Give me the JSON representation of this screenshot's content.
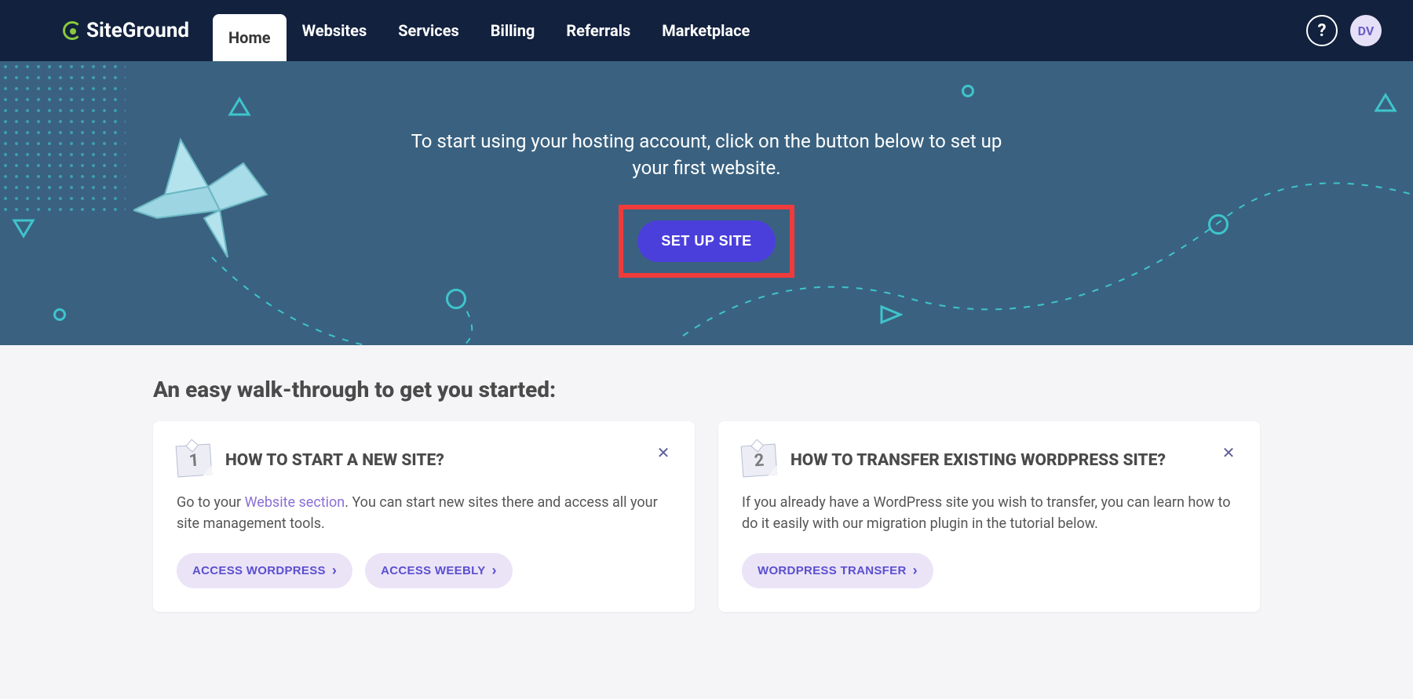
{
  "brand": "SiteGround",
  "nav": [
    "Home",
    "Websites",
    "Services",
    "Billing",
    "Referrals",
    "Marketplace"
  ],
  "nav_active_index": 0,
  "help_label": "?",
  "avatar_initials": "DV",
  "hero": {
    "text": "To start using your hosting account, click on the button below to set up your first website.",
    "button": "SET UP SITE"
  },
  "section_title": "An easy walk-through to get you started:",
  "cards": [
    {
      "num": "1",
      "title": "HOW TO START A NEW SITE?",
      "desc_pre": "Go to your ",
      "desc_link": "Website section",
      "desc_post": ". You can start new sites there and access all your site management tools.",
      "buttons": [
        "ACCESS WORDPRESS",
        "ACCESS WEEBLY"
      ]
    },
    {
      "num": "2",
      "title": "HOW TO TRANSFER EXISTING WORDPRESS SITE?",
      "desc_full": "If you already have a WordPress site you wish to transfer, you can learn how to do it easily with our migration plugin in the tutorial below.",
      "buttons": [
        "WORDPRESS TRANSFER"
      ]
    }
  ],
  "colors": {
    "accent": "#4b3fdc",
    "highlight_border": "#ef3b3b",
    "hero_bg": "#3a6280",
    "header_bg": "#12213e"
  }
}
